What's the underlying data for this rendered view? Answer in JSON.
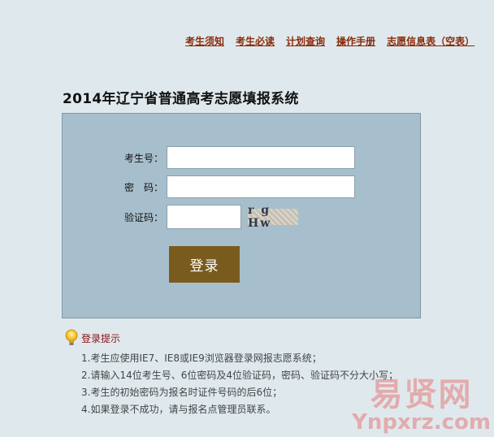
{
  "nav": {
    "items": [
      "考生须知",
      "考生必读",
      "计划查询",
      "操作手册",
      "志愿信息表（空表）"
    ]
  },
  "title": "2014年辽宁省普通高考志愿填报系统",
  "form": {
    "candidate_label": "考生号：",
    "candidate_value": "",
    "password_label": "密　码：",
    "password_value": "",
    "captcha_label": "验证码：",
    "captcha_value": "",
    "captcha_text": "r g Hw",
    "login_label": "登录"
  },
  "tips": {
    "heading": "登录提示",
    "items": [
      "1.考生应使用IE7、IE8或IE9浏览器登录网报志愿系统；",
      "2.请输入14位考生号、6位密码及4位验证码，密码、验证码不分大小写；",
      "3.考生的初始密码为报名时证件号码的后6位；",
      "4.如果登录不成功，请与报名点管理员联系。"
    ]
  },
  "watermark": {
    "line1": "易贤网",
    "line2": "Ynpxrz.com"
  },
  "colors": {
    "background": "#dfe9ed",
    "panel": "#a7bfcc",
    "nav_link": "#8a2a08",
    "login_button": "#7a5b1e",
    "tips_heading": "#8a1010"
  }
}
